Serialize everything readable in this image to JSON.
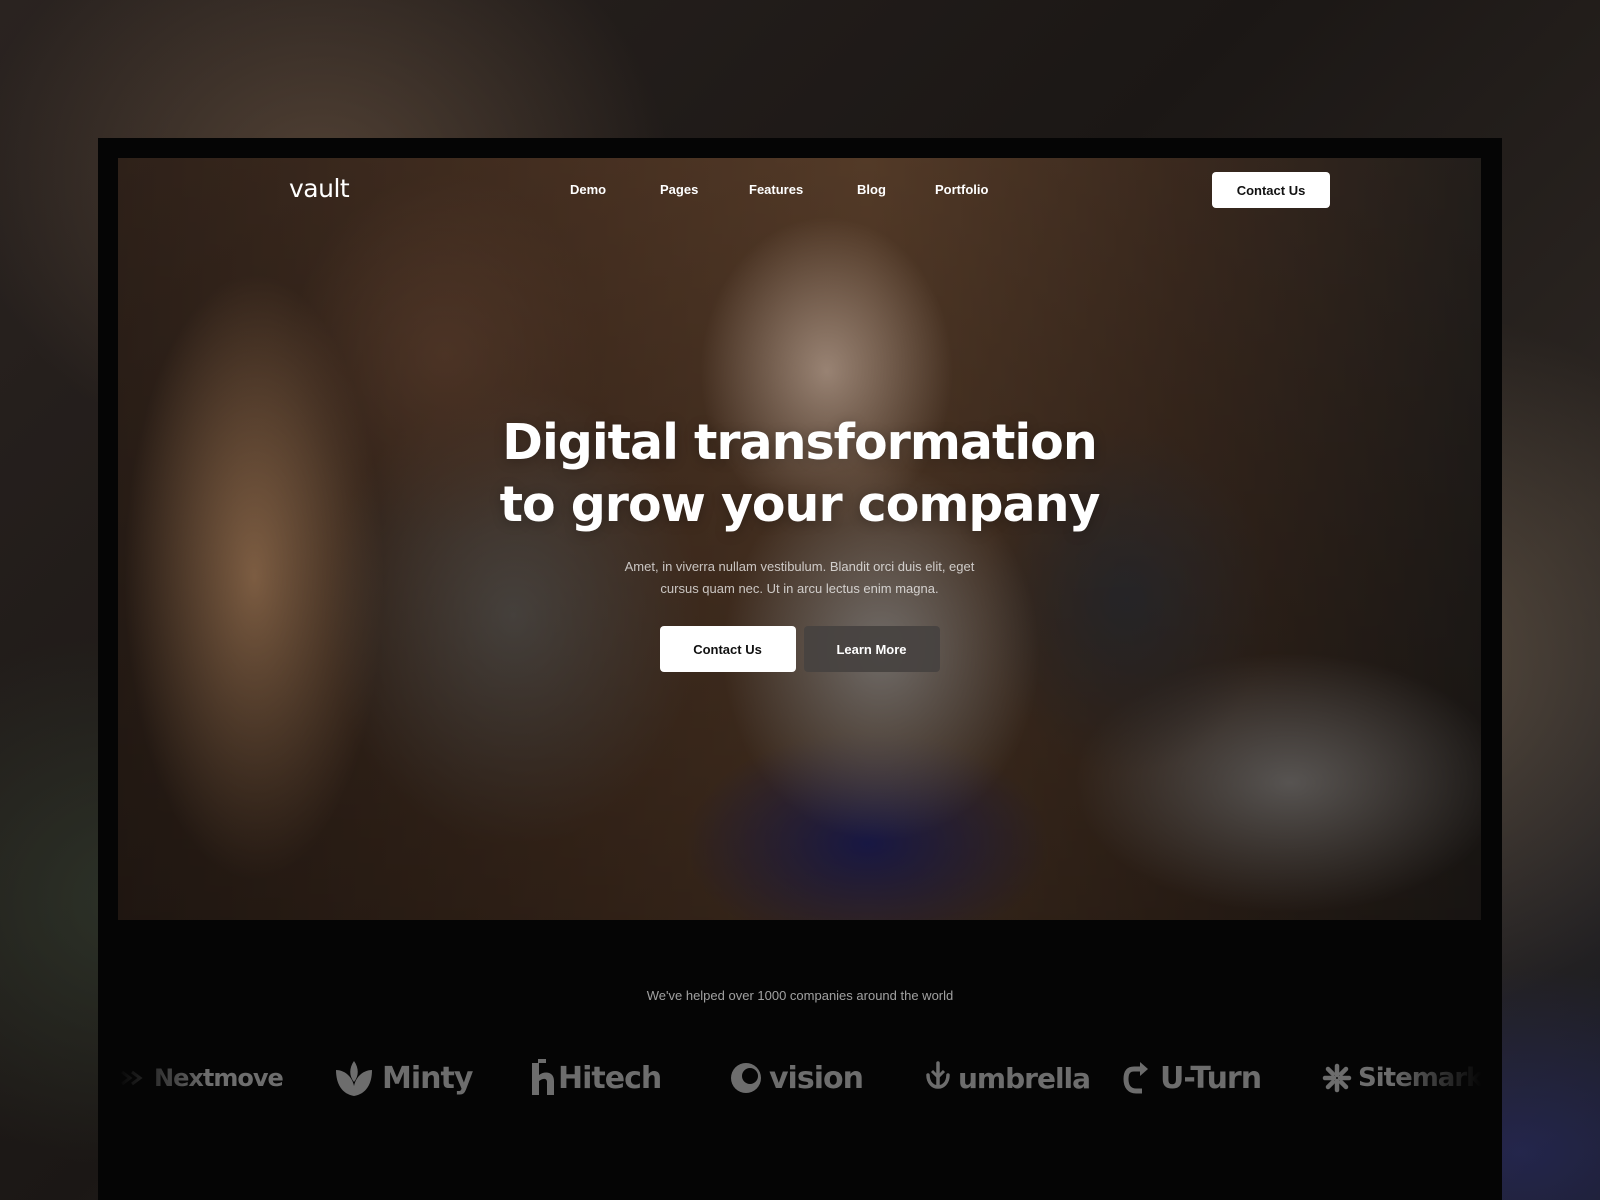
{
  "nav": {
    "logo": "vault",
    "links": [
      "Demo",
      "Pages",
      "Features",
      "Blog",
      "Portfolio"
    ],
    "cta": "Contact Us"
  },
  "hero": {
    "title_line1": "Digital transformation",
    "title_line2": "to grow your company",
    "subtitle_line1": "Amet, in viverra nullam vestibulum. Blandit orci duis elit, eget",
    "subtitle_line2": "cursus quam nec. Ut in arcu lectus enim magna.",
    "primary_button": "Contact Us",
    "secondary_button": "Learn More"
  },
  "clients": {
    "caption": "We've helped over 1000 companies around the world",
    "brands": [
      {
        "name": "Nextmove",
        "icon": "nextmove-icon"
      },
      {
        "name": "Minty",
        "icon": "leaf-icon"
      },
      {
        "name": "Hitech",
        "icon": "hitech-icon"
      },
      {
        "name": "vision",
        "icon": "vision-icon"
      },
      {
        "name": "umbrella",
        "icon": "umbrella-icon"
      },
      {
        "name": "U-Turn",
        "icon": "u-turn-arrow-icon"
      },
      {
        "name": "Sitemark",
        "icon": "sitemark-icon"
      }
    ]
  },
  "colors": {
    "page_bg": "#050505",
    "button_primary": "#ffffff",
    "button_secondary": "#46423f",
    "logo_gray": "#6d6d6d"
  }
}
